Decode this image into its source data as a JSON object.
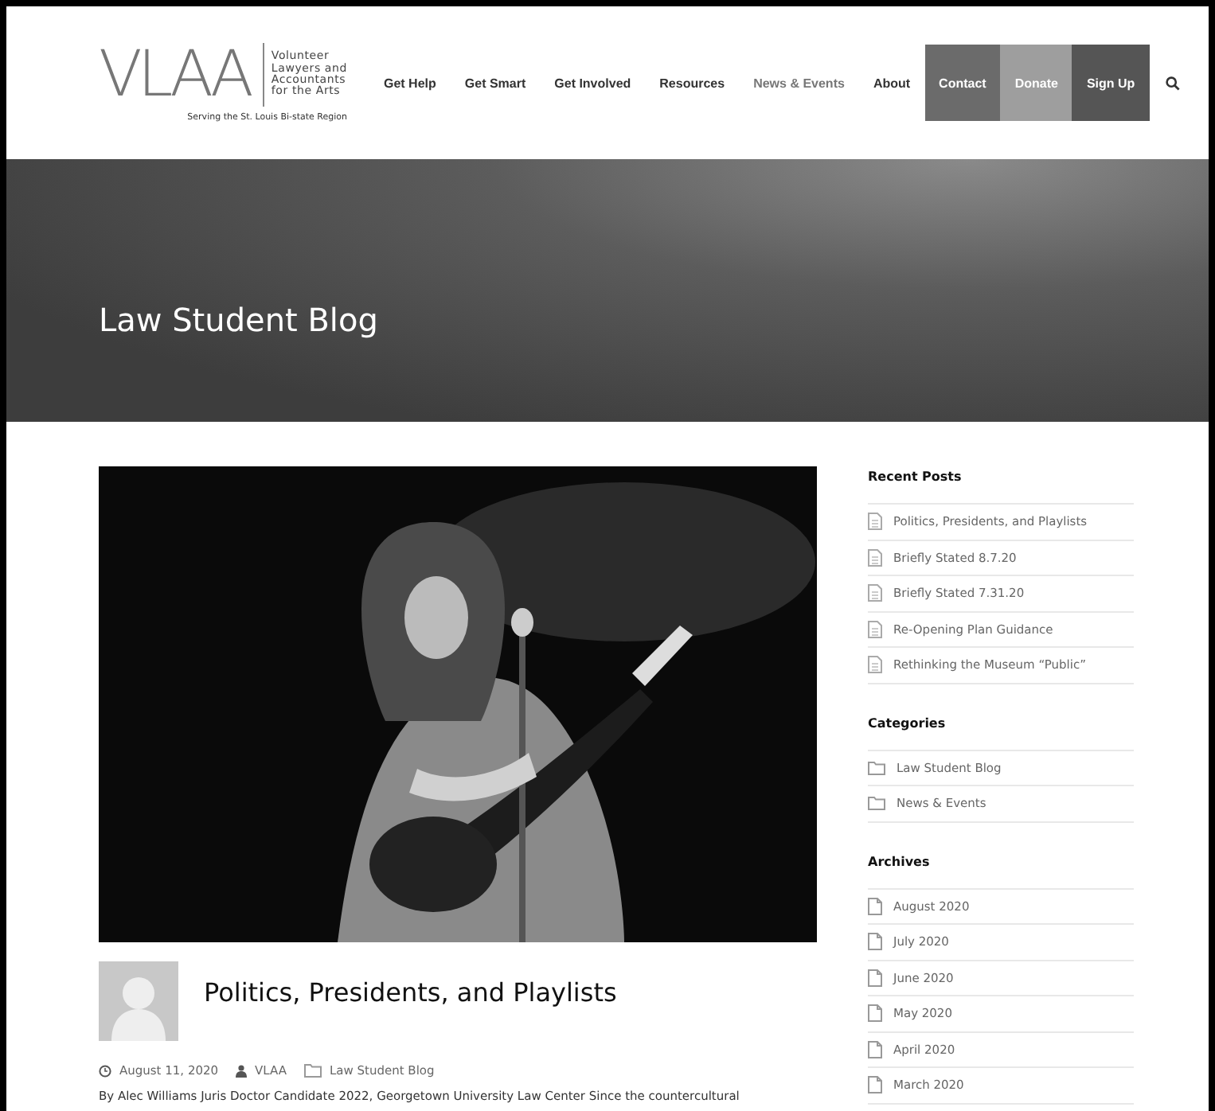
{
  "header": {
    "logo": {
      "mark": "VLAA",
      "lines": [
        "Volunteer",
        "Lawyers and",
        "Accountants",
        "for the Arts"
      ],
      "tagline": "Serving the St. Louis Bi-state Region"
    },
    "nav": [
      {
        "label": "Get Help",
        "kind": "link",
        "selected": false
      },
      {
        "label": "Get Smart",
        "kind": "link",
        "selected": false
      },
      {
        "label": "Get Involved",
        "kind": "link",
        "selected": false
      },
      {
        "label": "Resources",
        "kind": "link",
        "selected": false
      },
      {
        "label": "News & Events",
        "kind": "link",
        "selected": true
      },
      {
        "label": "About",
        "kind": "link",
        "selected": false
      },
      {
        "label": "Contact",
        "kind": "button",
        "color": "#6b6b6b"
      },
      {
        "label": "Donate",
        "kind": "button",
        "color": "#9e9e9e"
      },
      {
        "label": "Sign Up",
        "kind": "button",
        "color": "#555555"
      }
    ]
  },
  "hero": {
    "title": "Law Student Blog"
  },
  "post": {
    "title": "Politics, Presidents, and Playlists",
    "meta": {
      "date": "August 11, 2020",
      "author": "VLAA",
      "category": "Law Student Blog"
    },
    "excerpt": "By Alec Williams Juris Doctor Candidate 2022, Georgetown University Law Center Since the countercultural"
  },
  "sidebar": [
    {
      "heading": "Recent Posts",
      "kind": "posts",
      "items": [
        "Politics, Presidents, and Playlists",
        "Briefly Stated 8.7.20",
        "Briefly Stated 7.31.20",
        "Re-Opening Plan Guidance",
        "Rethinking the Museum “Public”"
      ]
    },
    {
      "heading": "Categories",
      "kind": "categories",
      "items": [
        "Law Student Blog",
        "News & Events"
      ]
    },
    {
      "heading": "Archives",
      "kind": "archives",
      "items": [
        "August 2020",
        "July 2020",
        "June 2020",
        "May 2020",
        "April 2020",
        "March 2020"
      ]
    }
  ]
}
